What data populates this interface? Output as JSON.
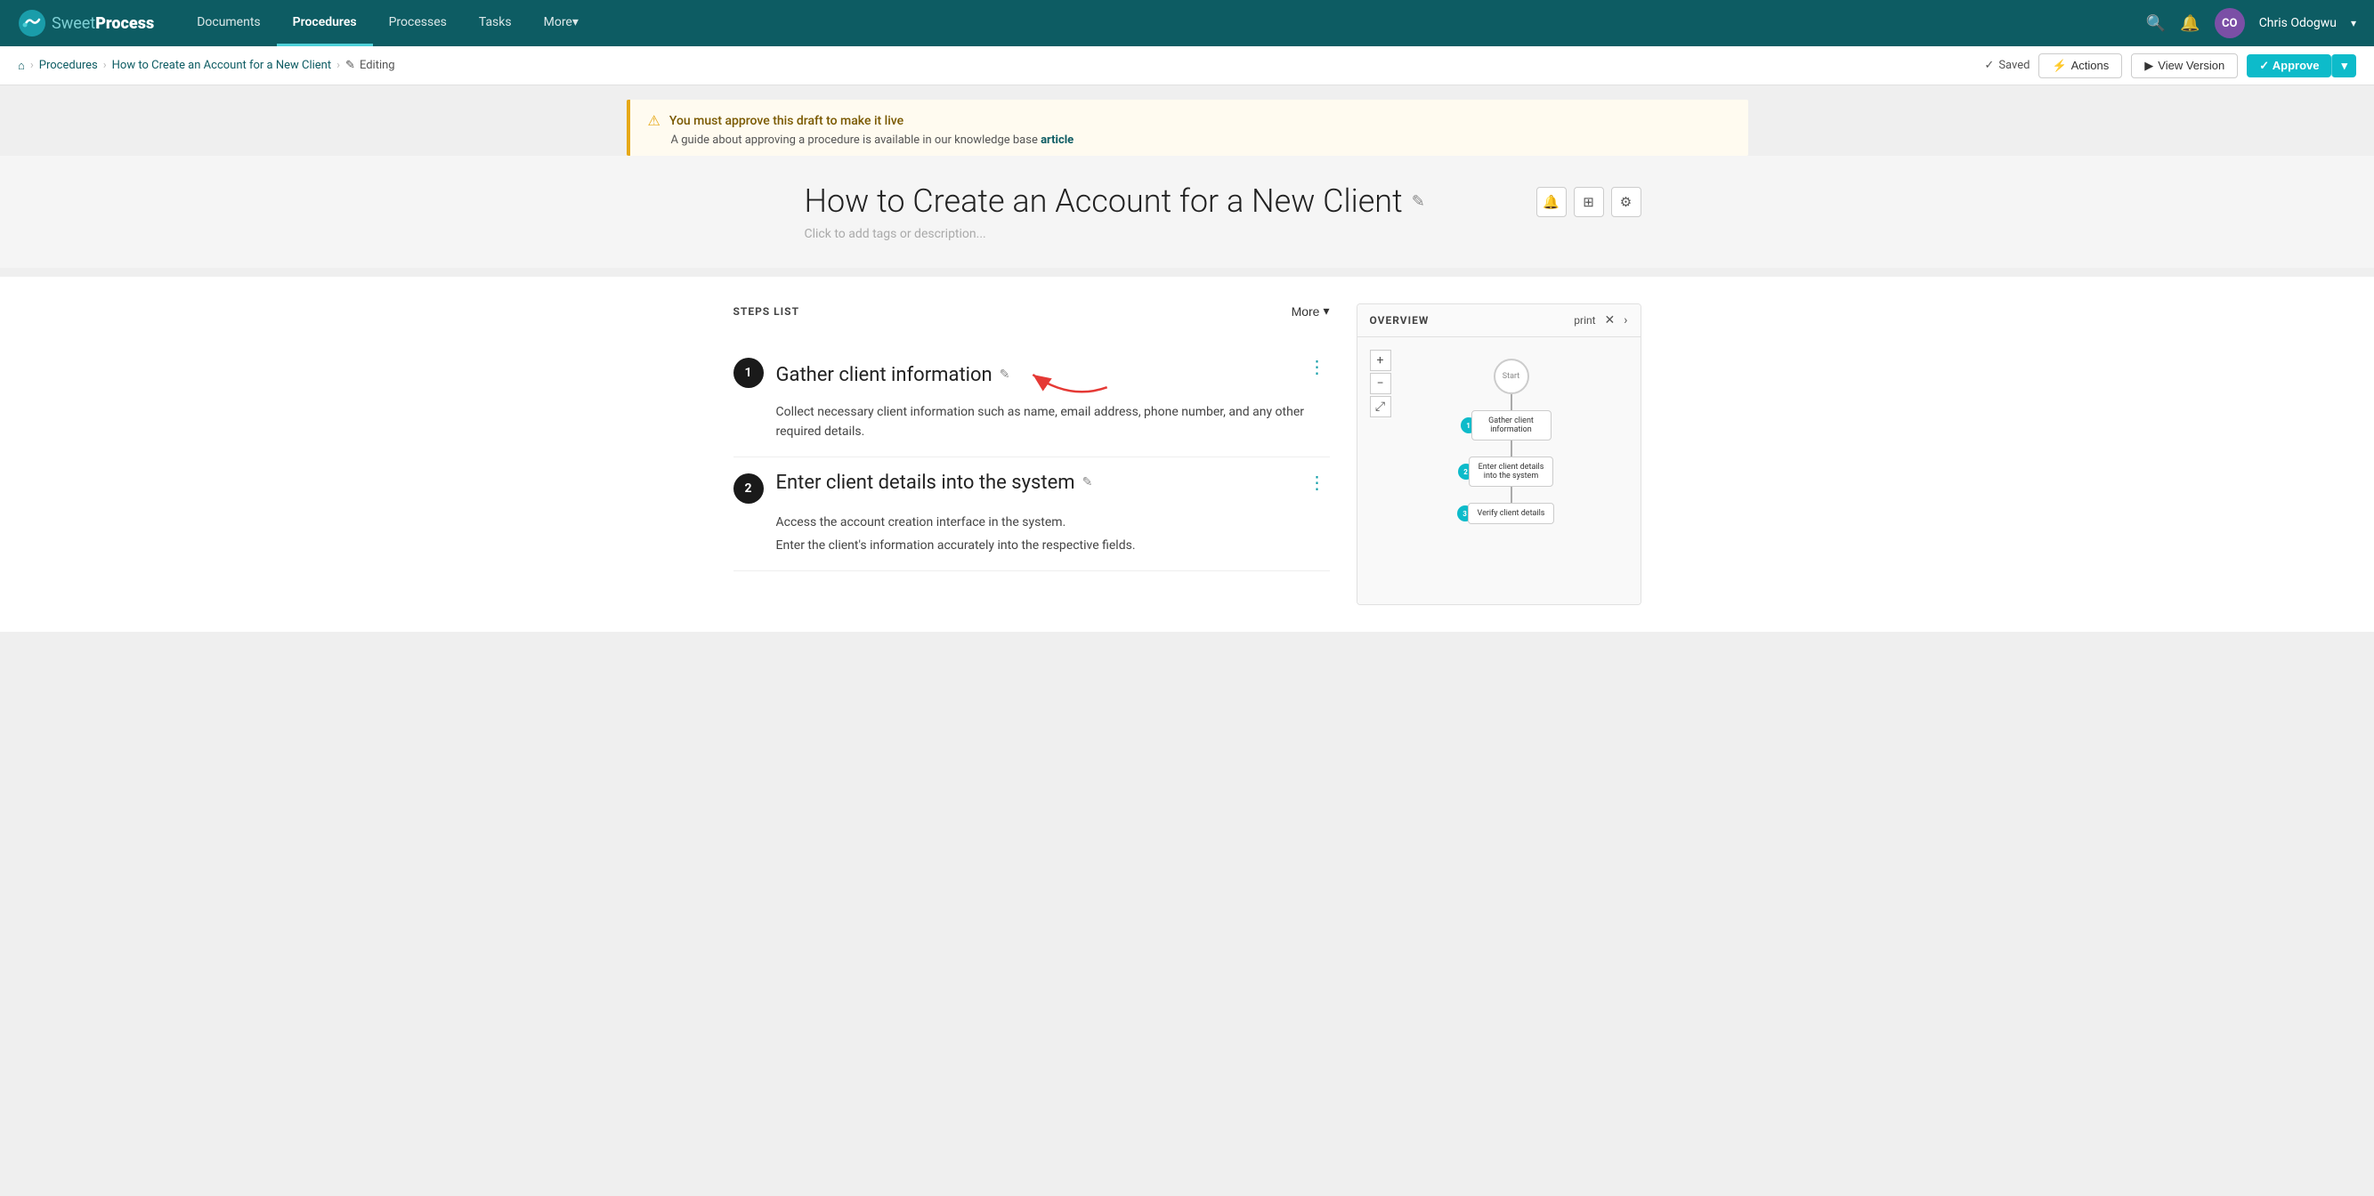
{
  "app": {
    "brand": "SweetProcess",
    "brand_sweet": "Sweet",
    "brand_process": "Process"
  },
  "nav": {
    "items": [
      {
        "label": "Documents",
        "active": false
      },
      {
        "label": "Procedures",
        "active": true
      },
      {
        "label": "Processes",
        "active": false
      },
      {
        "label": "Tasks",
        "active": false
      },
      {
        "label": "More",
        "active": false,
        "dropdown": true
      }
    ],
    "search_icon": "🔍",
    "bell_icon": "🔔",
    "user_initials": "CO",
    "username": "Chris Odogwu",
    "chevron": "▾"
  },
  "breadcrumb": {
    "home_icon": "⌂",
    "procedures_label": "Procedures",
    "procedure_name": "How to Create an Account for a New Client",
    "editing_label": "Editing",
    "pencil_icon": "✎",
    "saved_label": "Saved",
    "check_icon": "✓",
    "actions_label": "Actions",
    "bolt_icon": "⚡",
    "view_version_label": "View Version",
    "play_icon": "▶",
    "approve_label": "Approve",
    "approve_check": "✓",
    "dropdown_arrow": "▾"
  },
  "warning": {
    "icon": "⚠",
    "title": "You must approve this draft to make it live",
    "description": "A guide about approving a procedure is available in our knowledge base",
    "link_text": "article"
  },
  "procedure": {
    "title": "How to Create an Account for a New Client",
    "pencil_icon": "✎",
    "tags_placeholder": "Click to add tags or description...",
    "tool_bell": "🔔",
    "tool_columns": "⊞",
    "tool_gear": "⚙"
  },
  "steps": {
    "header_label": "STEPS LIST",
    "more_label": "More",
    "chevron": "▾",
    "items": [
      {
        "number": "1",
        "title": "Gather client information",
        "pencil": "✎",
        "description": "Collect necessary client information such as name, email address, phone number, and any other required details.",
        "menu_icon": "⋮"
      },
      {
        "number": "2",
        "title": "Enter client details into the system",
        "pencil": "✎",
        "description": "Access the account creation interface in the system.",
        "desc2": "Enter the client's information accurately into the respective fields.",
        "menu_icon": "⋮"
      }
    ]
  },
  "overview": {
    "title": "OVERVIEW",
    "print_label": "print",
    "close_icon": "✕",
    "expand_icon": "›",
    "zoom_plus": "+",
    "zoom_minus": "−",
    "zoom_fit": "⤢",
    "start_label": "Start",
    "flow_nodes": [
      {
        "number": "1",
        "label": "Gather client\ninformation"
      },
      {
        "number": "2",
        "label": "Enter client details\ninto the system"
      },
      {
        "number": "3",
        "label": "Verify client details"
      }
    ]
  }
}
